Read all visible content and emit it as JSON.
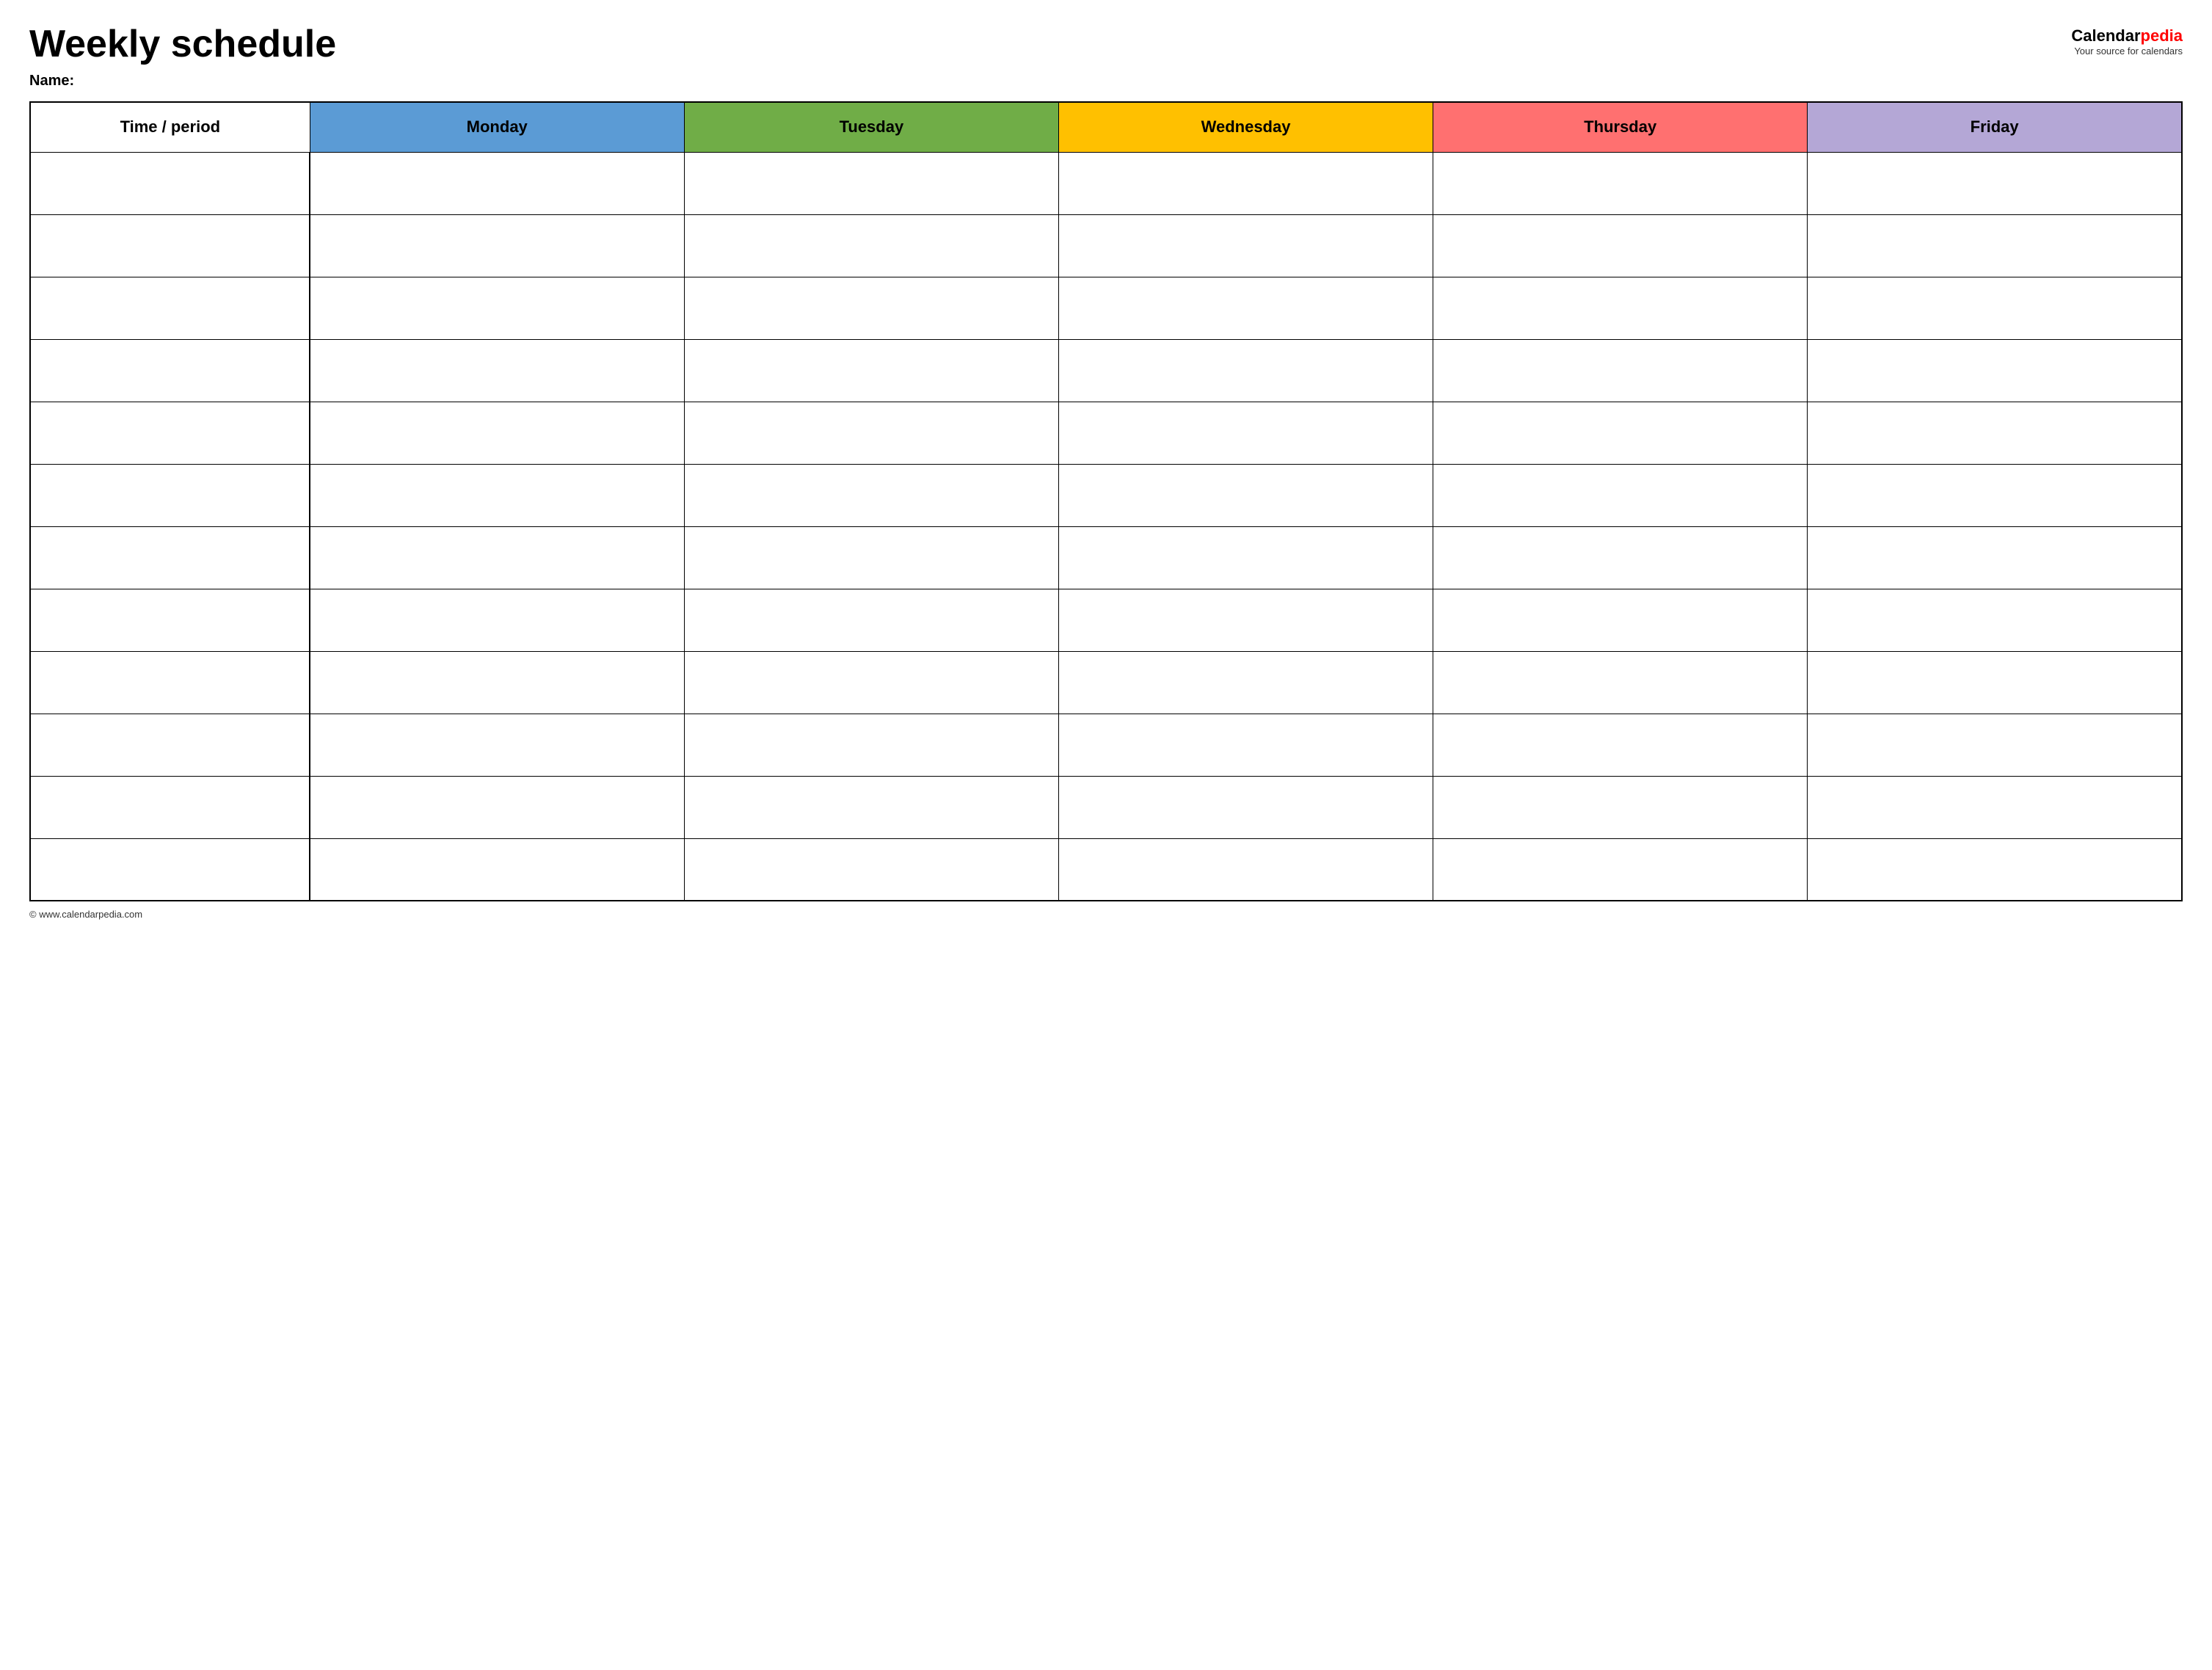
{
  "header": {
    "title": "Weekly schedule",
    "name_label": "Name:",
    "logo_calendar": "Calendar",
    "logo_pedia": "pedia",
    "logo_tagline": "Your source for calendars"
  },
  "table": {
    "columns": [
      {
        "id": "time",
        "label": "Time / period",
        "color": "#ffffff"
      },
      {
        "id": "monday",
        "label": "Monday",
        "color": "#5b9bd5"
      },
      {
        "id": "tuesday",
        "label": "Tuesday",
        "color": "#70ad47"
      },
      {
        "id": "wednesday",
        "label": "Wednesday",
        "color": "#ffc000"
      },
      {
        "id": "thursday",
        "label": "Thursday",
        "color": "#ff7070"
      },
      {
        "id": "friday",
        "label": "Friday",
        "color": "#b4a7d6"
      }
    ],
    "row_count": 12
  },
  "footer": {
    "copyright": "© www.calendarpedia.com"
  }
}
